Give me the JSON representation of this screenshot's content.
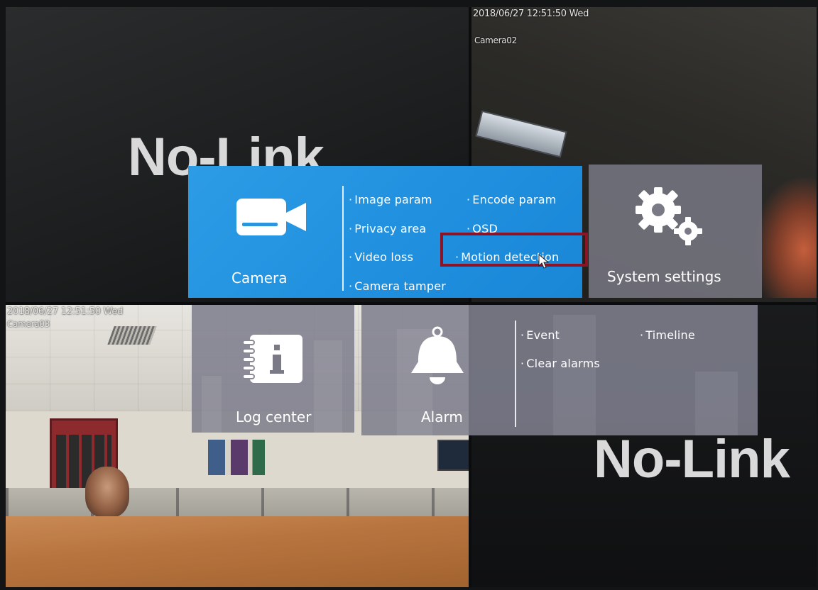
{
  "cameras": [
    {
      "id": "q1",
      "overlay": "No-Link"
    },
    {
      "id": "q2",
      "timestamp": "2018/06/27 12:51:50 Wed",
      "name": "Camera02"
    },
    {
      "id": "q3",
      "timestamp": "2018/06/27 12:51:50 Wed",
      "name": "Camera03"
    },
    {
      "id": "q4",
      "overlay": "No-Link"
    }
  ],
  "menu": {
    "camera": {
      "label": "Camera",
      "icon": "video-camera-icon",
      "options": [
        "Image param",
        "Encode param",
        "Privacy area",
        "OSD",
        "Video loss",
        "Motion detection",
        "Camera tamper"
      ],
      "selected": "Motion detection"
    },
    "system_settings": {
      "label": "System settings",
      "icon": "gears-icon"
    },
    "log_center": {
      "label": "Log center",
      "icon": "log-book-icon"
    },
    "alarm": {
      "label": "Alarm",
      "icon": "bell-icon",
      "options": [
        "Event",
        "Timeline",
        "Clear alarms"
      ]
    }
  },
  "colors": {
    "camera_tile": "#1f8fde",
    "gray_tile": "#808090",
    "highlight_border": "#8c1426"
  }
}
